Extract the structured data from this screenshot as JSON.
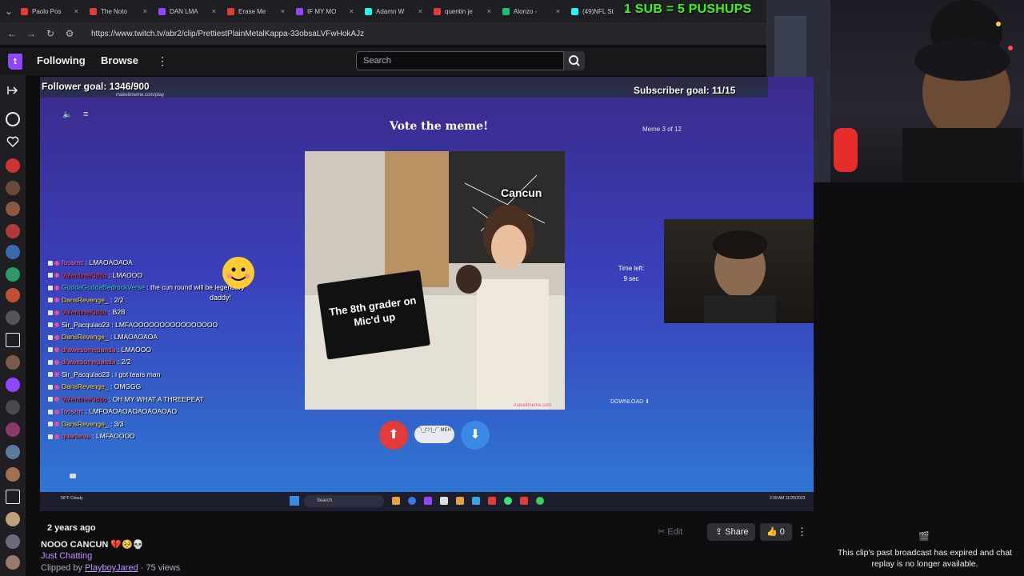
{
  "browser": {
    "tabs": [
      {
        "label": "Paolo Pos",
        "color": "#e53a3a"
      },
      {
        "label": "The Noto",
        "color": "#e53a3a"
      },
      {
        "label": "DAN LMA",
        "color": "#9146ff"
      },
      {
        "label": "Erase Me",
        "color": "#e53a3a"
      },
      {
        "label": "IF MY MO",
        "color": "#9146ff"
      },
      {
        "label": "Adamn W",
        "color": "#25f4ee"
      },
      {
        "label": "quentin je",
        "color": "#e53a3a"
      },
      {
        "label": "Alonzo -",
        "color": "#1dbf73"
      },
      {
        "label": "(49)NFL St",
        "color": "#25f4ee"
      }
    ],
    "url": "https://www.twitch.tv/abr2/clip/PrettiestPlainMetalKappa-33obsaLVFwHokAJz"
  },
  "overlay": {
    "sub_pushups": "1 SUB = 5 PUSHUPS",
    "follower_goal": "Follower goal: 1346/900",
    "subscriber_goal": "Subscriber goal: 11/15"
  },
  "topnav": {
    "following": "Following",
    "browse": "Browse",
    "more": "⋮",
    "search_placeholder": "Search"
  },
  "game": {
    "inner_url": "makeitmeme.com/play",
    "title": "Vote the meme!",
    "meme_counter": "Meme 3 of 12",
    "caption_top": "Cancun",
    "caption_bottom": "The 8th grader on Mic'd up",
    "watermark": "makeitmeme.com",
    "time_left_label": "Time left:",
    "time_left_value": "9 sec",
    "download": "DOWNLOAD",
    "meh": "¯\\_(ツ)_/¯ MEH"
  },
  "stream_chat": [
    {
      "user": "foosmc",
      "color": "#ff69b4",
      "msg": "LMAOAOAOA"
    },
    {
      "user": "ValentineKiddo",
      "color": "#e53a3a",
      "msg": "LMAOOO"
    },
    {
      "user": "GuddaGuddaBedrockVerse",
      "color": "#3cc",
      "msg": "the cun round will be legendary"
    },
    {
      "user": "DansRevenge_",
      "color": "#ffd23a",
      "msg": "2/2"
    },
    {
      "user": "ValentineKiddo",
      "color": "#e53a3a",
      "msg": "B2B"
    },
    {
      "user": "Sir_Pacquiao23",
      "color": "#ffffff",
      "msg": "LMFAOOOOOOOOOOOOOOOO"
    },
    {
      "user": "DansRevenge_",
      "color": "#ffd23a",
      "msg": "LMAOAOAOA"
    },
    {
      "user": "drawesomepanda",
      "color": "#ff5a5a",
      "msg": "LMAOOO"
    },
    {
      "user": "drawesomepanda",
      "color": "#ff5a5a",
      "msg": "2/2"
    },
    {
      "user": "Sir_Pacquiao23",
      "color": "#ffffff",
      "msg": "i got tears man"
    },
    {
      "user": "DansRevenge_",
      "color": "#ffd23a",
      "msg": "OMGGG"
    },
    {
      "user": "ValentineKiddo",
      "color": "#e53a3a",
      "msg": "OH MY WHAT A THREEPEAT"
    },
    {
      "user": "foosmc",
      "color": "#ff69b4",
      "msg": "LMFOAOAOAOAOAOAOAO"
    },
    {
      "user": "DansRevenge_",
      "color": "#ffd23a",
      "msg": "3/3"
    },
    {
      "user": "quarterva",
      "color": "#ff5a5a",
      "msg": "LMFAOOOO"
    }
  ],
  "emote_text": "daddy!",
  "taskbar": {
    "weather": "56°F Cloudy",
    "search": "Search",
    "clock": "2:39 AM 11/25/2023"
  },
  "clip_info": {
    "time_ago": "2 years ago",
    "title": "NOOO CANCUN 💔🥺💀",
    "category": "Just Chatting",
    "clipped_by_label": "Clipped by",
    "clipper": "PlayboyJared",
    "views": "· 75 views"
  },
  "actions": {
    "edit": "Edit",
    "share": "Share",
    "likes": "0",
    "more": "⋮"
  },
  "chat_panel": {
    "icon": "🎬",
    "expired": "This clip's past broadcast has expired and chat replay is no longer available."
  }
}
